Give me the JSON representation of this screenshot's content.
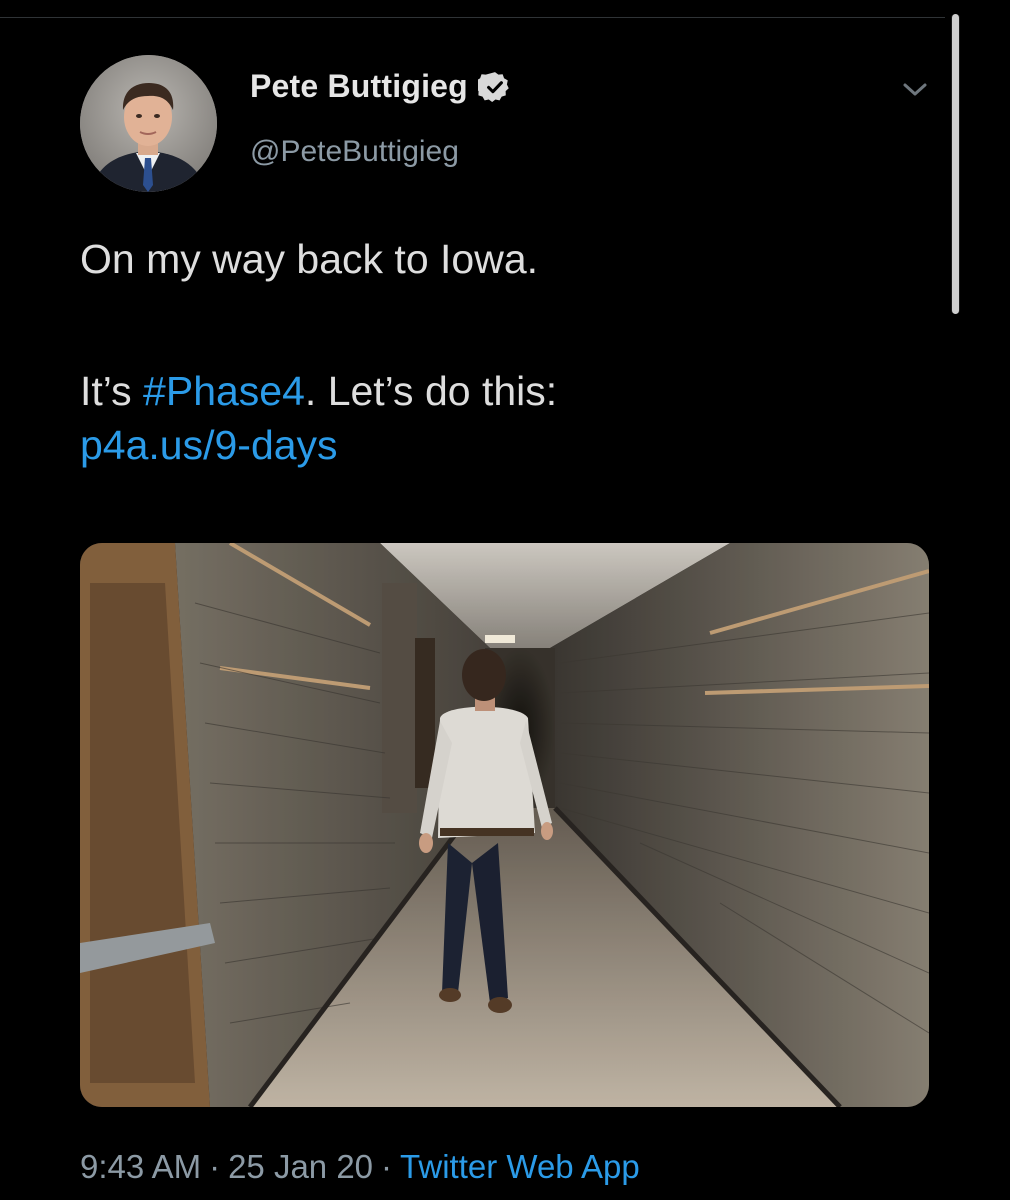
{
  "tweet": {
    "display_name": "Pete Buttigieg",
    "handle": "@PeteButtigieg",
    "verified_icon": "verified-badge-icon",
    "menu_icon": "chevron-down-icon",
    "text": {
      "line1": "On my way back to Iowa.",
      "line2_prefix": "It’s ",
      "hashtag": "#Phase4",
      "line2_suffix": ". Let’s do this:",
      "link": "p4a.us/9-days"
    },
    "media": {
      "kind": "photo"
    },
    "meta": {
      "time": "9:43 AM",
      "separator": "·",
      "date": "25 Jan 20",
      "source": "Twitter Web App"
    }
  },
  "colors": {
    "background": "#000000",
    "link_blue": "#2b9be8",
    "secondary_text": "#8c9aa5",
    "primary_text": "#dedede"
  }
}
